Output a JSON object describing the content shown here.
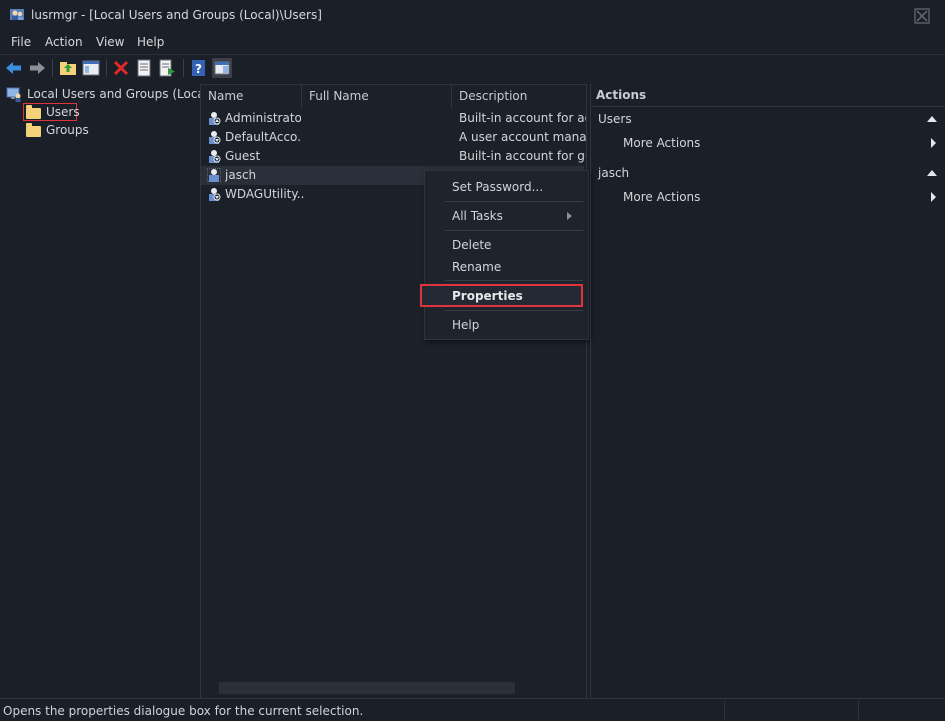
{
  "window": {
    "title": "lusrmgr - [Local Users and Groups (Local)\\Users]"
  },
  "menu": [
    "File",
    "Action",
    "View",
    "Help"
  ],
  "tree": {
    "root": "Local Users and Groups (Local)",
    "children": [
      "Users",
      "Groups"
    ],
    "selected": "Users"
  },
  "list": {
    "columns": [
      "Name",
      "Full Name",
      "Description"
    ],
    "rows": [
      {
        "name": "Administrator",
        "full_name": "",
        "description": "Built-in account for adm"
      },
      {
        "name": "DefaultAcco...",
        "full_name": "",
        "description": "A user account manage"
      },
      {
        "name": "Guest",
        "full_name": "",
        "description": "Built-in account for gue"
      },
      {
        "name": "jasch",
        "full_name": "",
        "description": ""
      },
      {
        "name": "WDAGUtility...",
        "full_name": "",
        "description": ""
      }
    ],
    "selected_row": "jasch"
  },
  "context_menu": {
    "items": [
      "Set Password...",
      "All Tasks",
      "Delete",
      "Rename",
      "Properties",
      "Help"
    ],
    "highlighted": "Properties"
  },
  "actions": {
    "header": "Actions",
    "sections": [
      {
        "title": "Users",
        "item": "More Actions"
      },
      {
        "title": "jasch",
        "item": "More Actions"
      }
    ]
  },
  "status": {
    "text": "Opens the properties dialogue box for the current selection."
  },
  "colors": {
    "background": "#1b1f27",
    "highlight_border": "#e0333c",
    "folder": "#f3d27a",
    "selected_row": "#2a2f3a"
  }
}
